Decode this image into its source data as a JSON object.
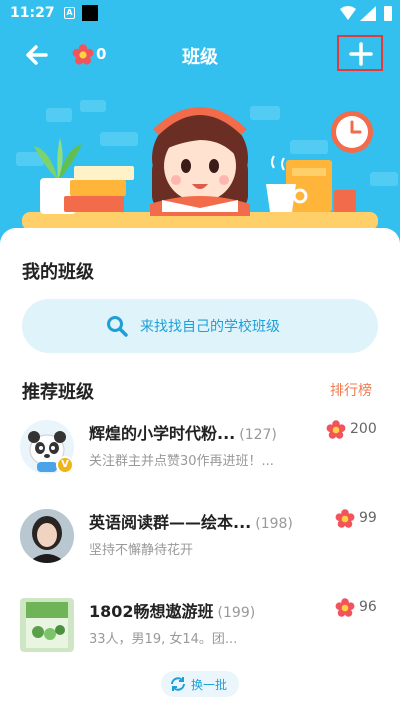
{
  "status_bar": {
    "time": "11:27",
    "badge_letter": "A"
  },
  "header": {
    "title": "班级",
    "flower_count": "0"
  },
  "colors": {
    "sky": "#34c0ef",
    "accent_blue": "#1f9fd8",
    "rank_orange": "#f07b52",
    "flower_red": "#f2545b",
    "highlight_red": "#e03a3a"
  },
  "icons": {
    "back": "arrow-left-icon",
    "flower": "flower-icon",
    "add": "plus-icon",
    "search": "search-icon",
    "refresh": "refresh-icon"
  },
  "my_class": {
    "title": "我的班级",
    "search_placeholder": "来找找自己的学校班级"
  },
  "recommended": {
    "title": "推荐班级",
    "rank_label": "排行榜",
    "items": [
      {
        "name": "辉煌的小学时代粉...",
        "members": "(127)",
        "desc": "关注群主并点赞30作再进班！...",
        "flowers": "200",
        "badge": "V"
      },
      {
        "name": "英语阅读群——绘本...",
        "members": "(198)",
        "desc": "坚持不懈静待花开",
        "flowers": "99"
      },
      {
        "name": "1802畅想遨游班",
        "members": "(199)",
        "desc": "33人，男19, 女14。团...",
        "flowers": "96"
      }
    ],
    "refresh_label": "换一批"
  }
}
